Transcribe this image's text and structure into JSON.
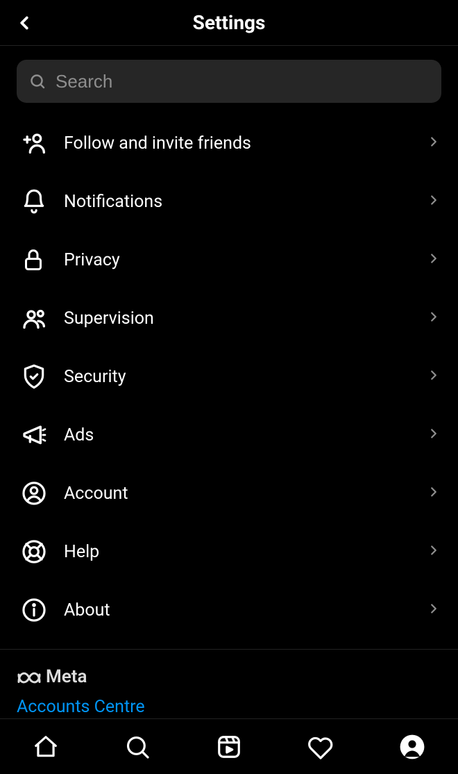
{
  "header": {
    "title": "Settings"
  },
  "search": {
    "placeholder": "Search"
  },
  "menu": [
    {
      "id": "follow-invite",
      "icon": "user-plus-icon",
      "label": "Follow and invite friends"
    },
    {
      "id": "notifications",
      "icon": "bell-icon",
      "label": "Notifications"
    },
    {
      "id": "privacy",
      "icon": "lock-icon",
      "label": "Privacy"
    },
    {
      "id": "supervision",
      "icon": "people-icon",
      "label": "Supervision"
    },
    {
      "id": "security",
      "icon": "shield-icon",
      "label": "Security"
    },
    {
      "id": "ads",
      "icon": "megaphone-icon",
      "label": "Ads"
    },
    {
      "id": "account",
      "icon": "account-icon",
      "label": "Account"
    },
    {
      "id": "help",
      "icon": "lifebuoy-icon",
      "label": "Help"
    },
    {
      "id": "about",
      "icon": "info-icon",
      "label": "About"
    }
  ],
  "meta": {
    "brand": "Meta",
    "accounts_link": "Accounts Centre"
  },
  "tabs": [
    {
      "id": "home",
      "icon": "home-icon"
    },
    {
      "id": "search",
      "icon": "search-icon"
    },
    {
      "id": "reels",
      "icon": "reels-icon"
    },
    {
      "id": "activity",
      "icon": "heart-icon"
    },
    {
      "id": "profile",
      "icon": "profile-icon"
    }
  ]
}
